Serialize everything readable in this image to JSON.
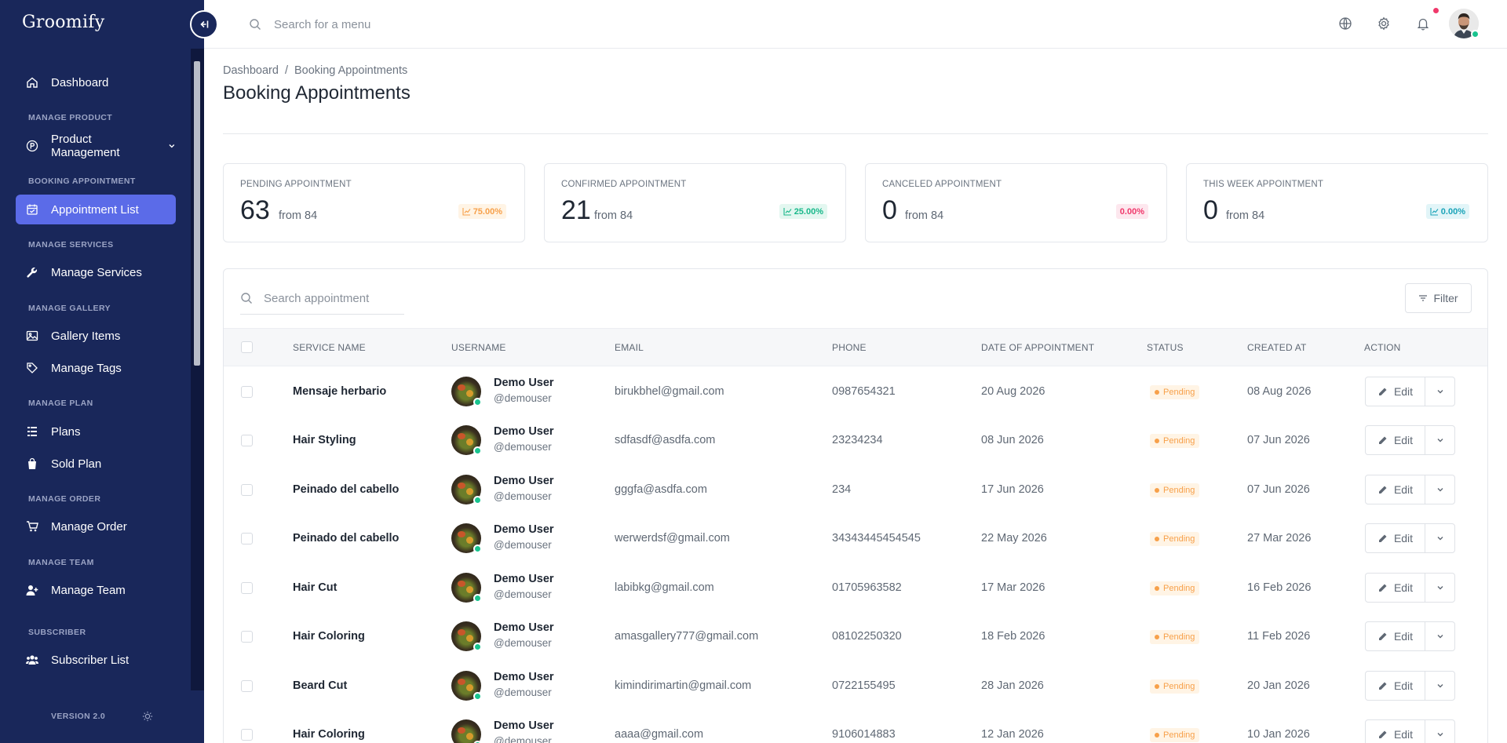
{
  "sidebar": {
    "brand": "Groomify",
    "version": "VERSION 2.0",
    "sections": {
      "manage_product": "MANAGE PRODUCT",
      "booking_appointment": "BOOKING APPOINTMENT",
      "manage_services": "MANAGE SERVICES",
      "manage_gallery": "MANAGE GALLERY",
      "manage_plan": "MANAGE PLAN",
      "manage_order": "MANAGE ORDER",
      "manage_team": "MANAGE TEAM",
      "subscriber": "SUBSCRIBER"
    },
    "items": {
      "dashboard": "Dashboard",
      "product_management": "Product Management",
      "appointment_list": "Appointment List",
      "manage_services": "Manage Services",
      "gallery_items": "Gallery Items",
      "manage_tags": "Manage Tags",
      "plans": "Plans",
      "sold_plan": "Sold Plan",
      "manage_order": "Manage Order",
      "manage_team": "Manage Team",
      "subscriber_list": "Subscriber List"
    }
  },
  "topbar": {
    "search_placeholder": "Search for a menu"
  },
  "breadcrumb": {
    "home": "Dashboard",
    "separator": "/",
    "current": "Booking Appointments"
  },
  "page": {
    "title": "Booking Appointments"
  },
  "stats": [
    {
      "label": "PENDING APPOINTMENT",
      "value": "63",
      "from": "from 84",
      "badge": "75.00%",
      "color": "#f7a04a",
      "bg": "#fff4e5"
    },
    {
      "label": "CONFIRMED APPOINTMENT",
      "value": "21",
      "from": "from 84",
      "badge": "25.00%",
      "color": "#19b88a",
      "bg": "#e3f7f0"
    },
    {
      "label": "CANCELED APPOINTMENT",
      "value": "0",
      "from": "from 84",
      "badge": "0.00%",
      "color": "#f0386b",
      "bg": "#fde7ee"
    },
    {
      "label": "THIS WEEK APPOINTMENT",
      "value": "0",
      "from": "from 84",
      "badge": "0.00%",
      "color": "#1aa3b8",
      "bg": "#e2f5f8"
    }
  ],
  "table": {
    "search_placeholder": "Search appointment",
    "filter_label": "Filter",
    "edit_label": "Edit",
    "columns": [
      "SERVICE NAME",
      "USERNAME",
      "EMAIL",
      "PHONE",
      "DATE OF APPOINTMENT",
      "STATUS",
      "CREATED AT",
      "ACTION"
    ],
    "rows": [
      {
        "service": "Mensaje herbario",
        "name": "Demo User",
        "handle": "@demouser",
        "email": "birukbhel@gmail.com",
        "phone": "0987654321",
        "date": "20 Aug 2026",
        "status": "Pending",
        "created": "08 Aug 2026"
      },
      {
        "service": "Hair Styling",
        "name": "Demo User",
        "handle": "@demouser",
        "email": "sdfasdf@asdfa.com",
        "phone": "23234234",
        "date": "08 Jun 2026",
        "status": "Pending",
        "created": "07 Jun 2026"
      },
      {
        "service": "Peinado del cabello",
        "name": "Demo User",
        "handle": "@demouser",
        "email": "gggfa@asdfa.com",
        "phone": "234",
        "date": "17 Jun 2026",
        "status": "Pending",
        "created": "07 Jun 2026"
      },
      {
        "service": "Peinado del cabello",
        "name": "Demo User",
        "handle": "@demouser",
        "email": "werwerdsf@gmail.com",
        "phone": "34343445454545",
        "date": "22 May 2026",
        "status": "Pending",
        "created": "27 Mar 2026"
      },
      {
        "service": "Hair Cut",
        "name": "Demo User",
        "handle": "@demouser",
        "email": "labibkg@gmail.com",
        "phone": "01705963582",
        "date": "17 Mar 2026",
        "status": "Pending",
        "created": "16 Feb 2026"
      },
      {
        "service": "Hair Coloring",
        "name": "Demo User",
        "handle": "@demouser",
        "email": "amasgallery777@gmail.com",
        "phone": "08102250320",
        "date": "18 Feb 2026",
        "status": "Pending",
        "created": "11 Feb 2026"
      },
      {
        "service": "Beard Cut",
        "name": "Demo User",
        "handle": "@demouser",
        "email": "kimindirimartin@gmail.com",
        "phone": "0722155495",
        "date": "28 Jan 2026",
        "status": "Pending",
        "created": "20 Jan 2026"
      },
      {
        "service": "Hair Coloring",
        "name": "Demo User",
        "handle": "@demouser",
        "email": "aaaa@gmail.com",
        "phone": "9106014883",
        "date": "12 Jan 2026",
        "status": "Pending",
        "created": "10 Jan 2026"
      }
    ]
  }
}
